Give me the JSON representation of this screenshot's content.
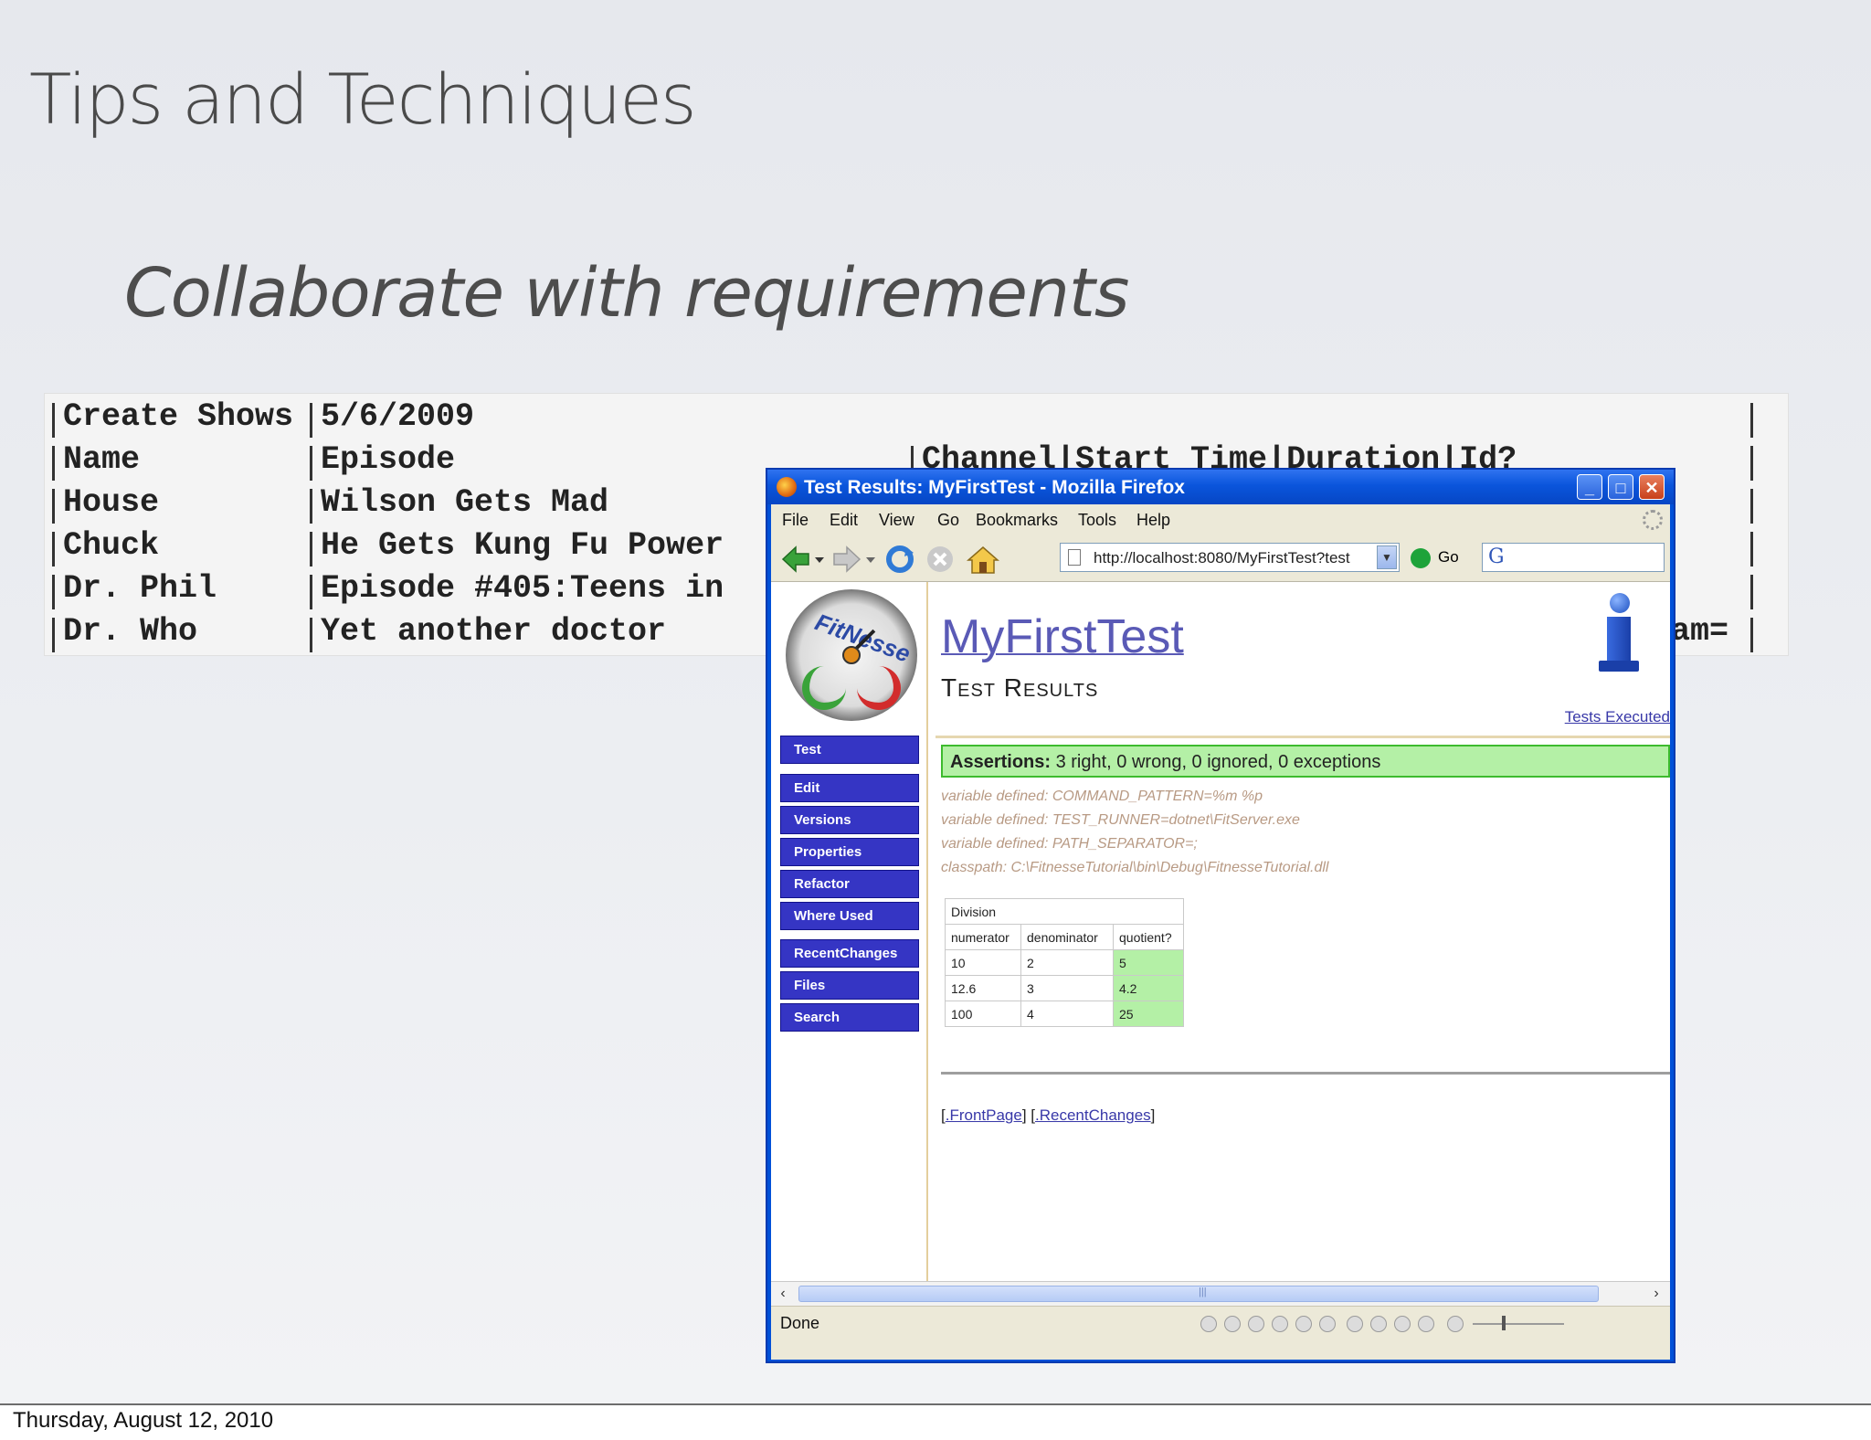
{
  "slide": {
    "title": "Tips and Techniques",
    "subtitle": "Collaborate with requirements",
    "date": "Thursday, August 12, 2010"
  },
  "code_table": {
    "rows": [
      {
        "c1": "Create Shows",
        "c2": "5/6/2009",
        "c3": ""
      },
      {
        "c1": "Name",
        "c2": "Episode",
        "c3": "Channel|Start Time|Duration|Id?"
      },
      {
        "c1": "House",
        "c2": "Wilson Gets Mad",
        "c3": ""
      },
      {
        "c1": "Chuck",
        "c2": "He Gets Kung Fu Power",
        "c3": ""
      },
      {
        "c1": "Dr. Phil",
        "c2": "Episode #405:Teens in",
        "c3": ""
      },
      {
        "c1": "Dr. Who",
        "c2": "Yet another doctor",
        "c3": "am="
      }
    ]
  },
  "browser": {
    "window_title": "Test Results: MyFirstTest - Mozilla Firefox",
    "menu": [
      "File",
      "Edit",
      "View",
      "Go",
      "Bookmarks",
      "Tools",
      "Help"
    ],
    "url": "http://localhost:8080/MyFirstTest?test",
    "go_label": "Go",
    "search_engine_letter": "G",
    "status": "Done",
    "scroll_thumb_glyph": "|||",
    "win_buttons": {
      "minimize": "_",
      "maximize": "□",
      "close": "✕"
    }
  },
  "fitnesse": {
    "logo_text": "FitNesse",
    "nav": [
      "Test",
      "Edit",
      "Versions",
      "Properties",
      "Refactor",
      "Where Used",
      "RecentChanges",
      "Files",
      "Search"
    ],
    "page_title": "MyFirstTest",
    "page_subtitle": "Test Results",
    "tests_executed": "Tests Executed",
    "assertions_label": "Assertions:",
    "assertions_text": "3 right, 0 wrong, 0 ignored, 0 exceptions",
    "variables": [
      "variable defined: COMMAND_PATTERN=%m %p",
      "variable defined: TEST_RUNNER=dotnet\\FitServer.exe",
      "variable defined: PATH_SEPARATOR=;",
      "classpath: C:\\FitnesseTutorial\\bin\\Debug\\FitnesseTutorial.dll"
    ],
    "table": {
      "name": "Division",
      "headers": [
        "numerator",
        "denominator",
        "quotient?"
      ],
      "rows": [
        [
          "10",
          "2",
          "5"
        ],
        [
          "12.6",
          "3",
          "4.2"
        ],
        [
          "100",
          "4",
          "25"
        ]
      ]
    },
    "footer_links": [
      ".FrontPage",
      ".RecentChanges"
    ]
  }
}
